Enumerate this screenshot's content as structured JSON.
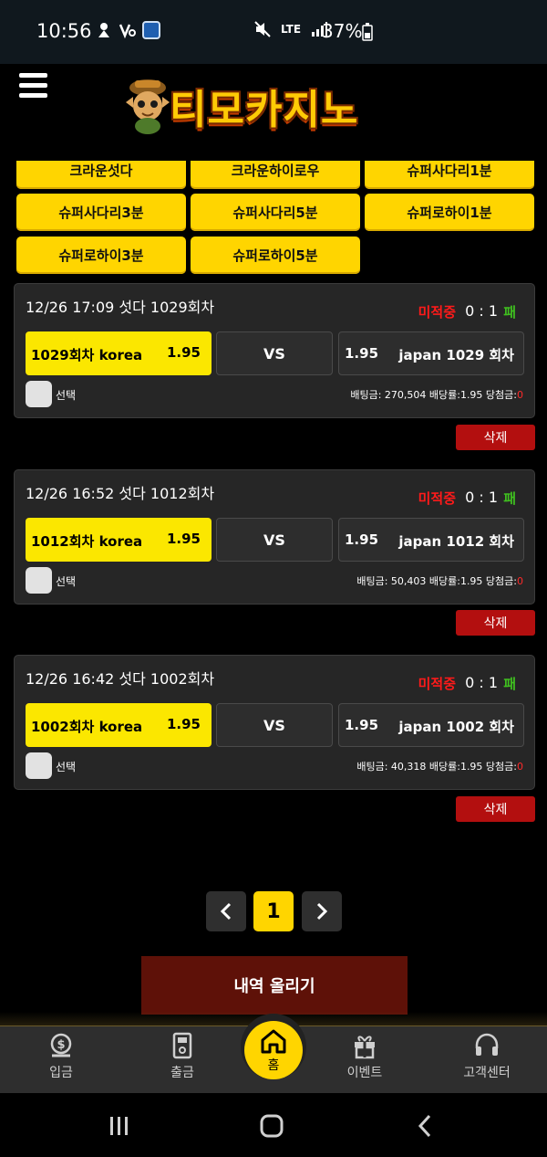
{
  "status_bar": {
    "time": "10:56",
    "network": "LTE",
    "battery": "37%"
  },
  "header": {
    "logo_text": "티모카지노"
  },
  "categories": [
    "크라운섯다",
    "크라운하이로우",
    "슈퍼사다리1분",
    "슈퍼사다리3분",
    "슈퍼사다리5분",
    "슈퍼로하이1분",
    "슈퍼로하이3분",
    "슈퍼로하이5분"
  ],
  "bets": [
    {
      "title": "12/26 17:09   섯다 1029회차",
      "status": "미적중",
      "score": "0 : 1",
      "result": "패",
      "home_name": "1029회차 korea",
      "home_odds": "1.95",
      "vs": "VS",
      "away_odds": "1.95",
      "away_name": "japan 1029 회차",
      "select_label": "선택",
      "info": "배팅금: 270,504 배당률:1.95 당첨금:",
      "win": "0",
      "delete": "삭제"
    },
    {
      "title": "12/26 16:52   섯다 1012회차",
      "status": "미적중",
      "score": "0 : 1",
      "result": "패",
      "home_name": "1012회차 korea",
      "home_odds": "1.95",
      "vs": "VS",
      "away_odds": "1.95",
      "away_name": "japan 1012 회차",
      "select_label": "선택",
      "info": "배팅금: 50,403 배당률:1.95 당첨금:",
      "win": "0",
      "delete": "삭제"
    },
    {
      "title": "12/26 16:42   섯다 1002회차",
      "status": "미적중",
      "score": "0 : 1",
      "result": "패",
      "home_name": "1002회차 korea",
      "home_odds": "1.95",
      "vs": "VS",
      "away_odds": "1.95",
      "away_name": "japan 1002 회차",
      "select_label": "선택",
      "info": "배팅금: 40,318 배당률:1.95 당첨금:",
      "win": "0",
      "delete": "삭제"
    }
  ],
  "pagination": {
    "prev": "‹",
    "current": "1",
    "next": "›"
  },
  "history_button": "내역 올리기",
  "bottom_nav": {
    "deposit": "입금",
    "withdraw": "출금",
    "home": "홈",
    "event": "이벤트",
    "support": "고객센터"
  },
  "colors": {
    "accent": "#ffd500",
    "lose": "#ff1a1a",
    "result": "#3fbf1f",
    "delete": "#b30f0f"
  }
}
